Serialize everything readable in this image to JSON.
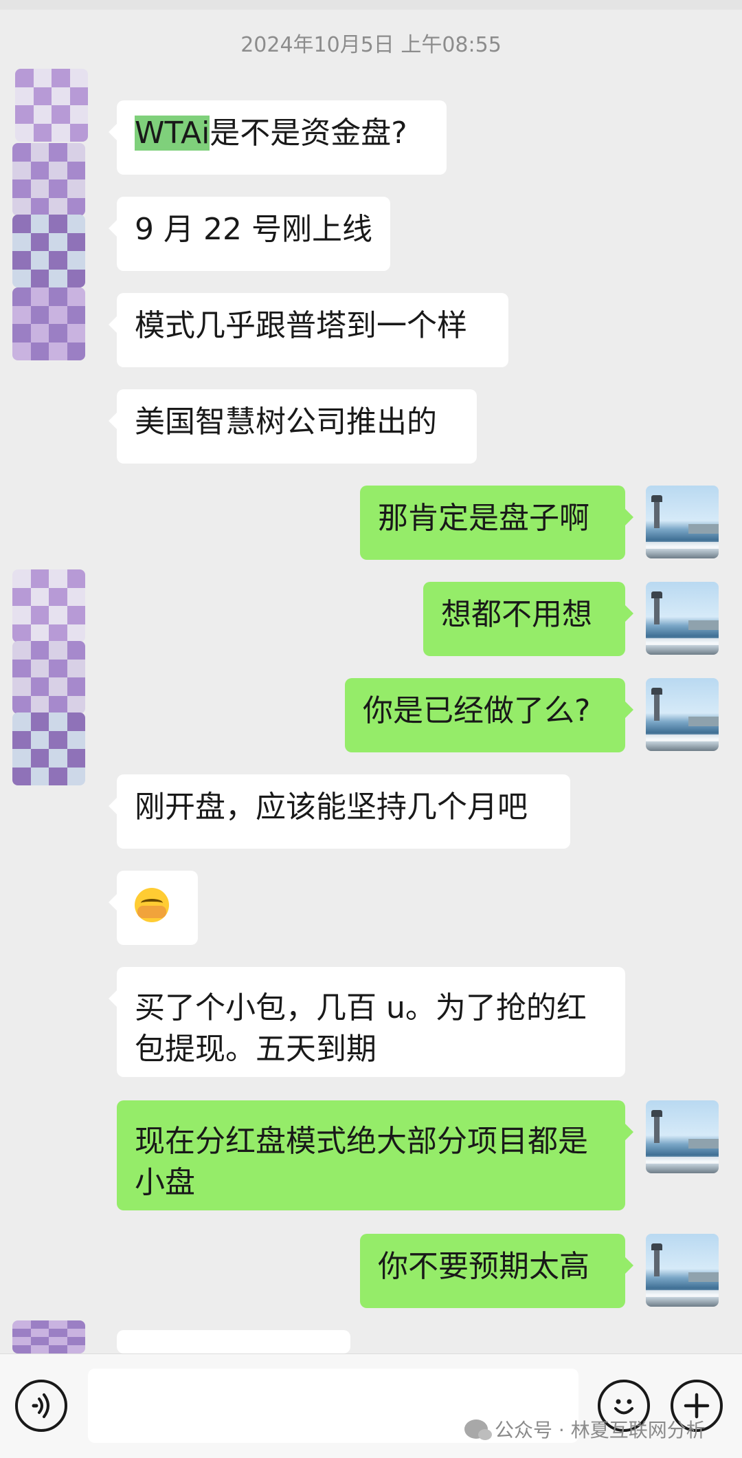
{
  "chat": {
    "timestamp": "2024年10月5日 上午08:55",
    "messages": [
      {
        "side": "left",
        "highlight": "WTAi",
        "text": "是不是资金盘?"
      },
      {
        "side": "left",
        "text": "9 月 22 号刚上线"
      },
      {
        "side": "left",
        "text": "模式几乎跟普塔到一个样"
      },
      {
        "side": "left",
        "text": "美国智慧树公司推出的"
      },
      {
        "side": "right",
        "text": "那肯定是盘子啊"
      },
      {
        "side": "right",
        "text": "想都不用想"
      },
      {
        "side": "right",
        "text": "你是已经做了么?"
      },
      {
        "side": "left",
        "text": "刚开盘，应该能坚持几个月吧"
      },
      {
        "side": "left",
        "emoji": "face-with-tears-emoji"
      },
      {
        "side": "left",
        "line1": "买了个小包，几百 u。为了抢的红",
        "line2": "包提现。五天到期"
      },
      {
        "side": "right",
        "line1": "现在分红盘模式绝大部分项目都是",
        "line2": "小盘"
      },
      {
        "side": "right",
        "text": "你不要预期太高"
      }
    ]
  },
  "input_bar": {
    "voice_icon": "voice-icon",
    "emoji_icon": "emoji-icon",
    "plus_icon": "plus-icon"
  },
  "watermark": {
    "text": "公众号 · 林夏互联网分析"
  },
  "colors": {
    "background": "#ededed",
    "bubble_sent": "#95ec69",
    "bubble_received": "#ffffff",
    "highlight": "#7fd07b"
  }
}
